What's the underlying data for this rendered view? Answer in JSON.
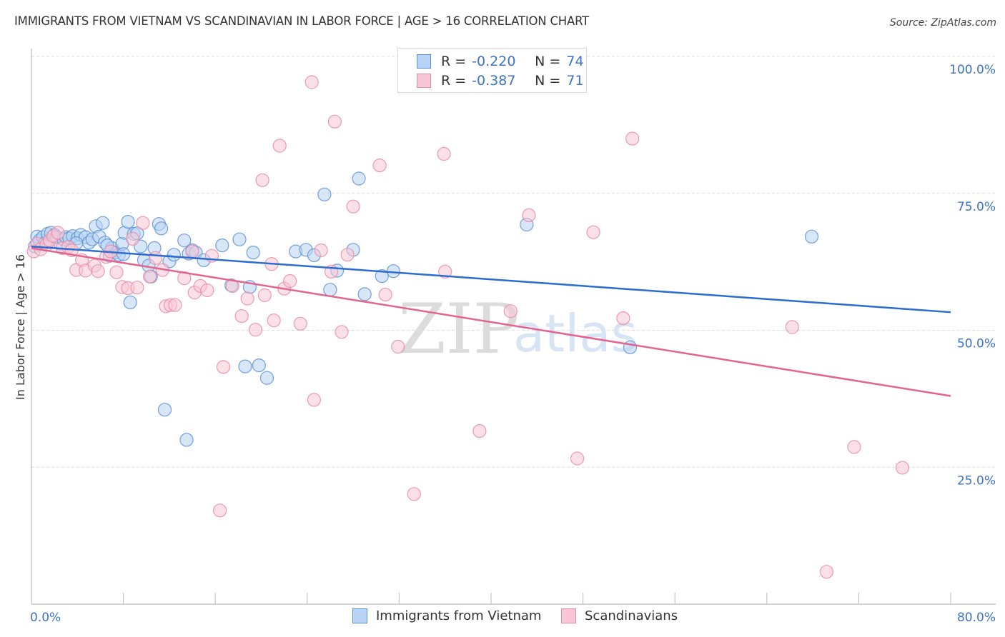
{
  "header": {
    "title": "IMMIGRANTS FROM VIETNAM VS SCANDINAVIAN IN LABOR FORCE | AGE > 16 CORRELATION CHART",
    "source": "Source: ZipAtlas.com"
  },
  "legend": {
    "rows": [
      {
        "r_label": "R =",
        "r_value": "-0.220",
        "n_label": "N =",
        "n_value": "74"
      },
      {
        "r_label": "R =",
        "r_value": "-0.387",
        "n_label": "N =",
        "n_value": "71"
      }
    ]
  },
  "bottom_legend": {
    "series_1": "Immigrants from Vietnam",
    "series_2": "Scandinavians"
  },
  "watermark": {
    "zip": "ZIP",
    "atlas": "atlas"
  },
  "colors": {
    "blue_fill": "#b8d3f3",
    "blue_stroke": "#5a8fd8",
    "blue_line": "#2a6ccf",
    "pink_fill": "#f9c6d5",
    "pink_stroke": "#e88aa6",
    "pink_line": "#e2648f",
    "tick_text": "#3b73c8",
    "grid": "#dddddd"
  },
  "chart_data": {
    "type": "scatter",
    "title": "IMMIGRANTS FROM VIETNAM VS SCANDINAVIAN IN LABOR FORCE | AGE > 16 CORRELATION CHART",
    "xlabel": "",
    "ylabel": "In Labor Force | Age > 16",
    "xlim": [
      0,
      80
    ],
    "ylim": [
      0,
      100
    ],
    "x_tick_labels": [
      "0.0%",
      "80.0%"
    ],
    "x_ticks": [
      0,
      8,
      16,
      24,
      32,
      40,
      48,
      56,
      64,
      72,
      80
    ],
    "y_ticks": [
      25,
      50,
      75,
      100
    ],
    "y_tick_labels": [
      "25.0%",
      "50.0%",
      "75.0%",
      "100.0%"
    ],
    "grid": "horizontal-dashed",
    "legend_position": "top-center",
    "series": [
      {
        "name": "Immigrants from Vietnam",
        "R": -0.22,
        "N": 74,
        "trend": {
          "x": [
            0,
            80
          ],
          "y": [
            65.3,
            53.3
          ]
        },
        "points": [
          [
            0.3,
            65.3
          ],
          [
            0.5,
            67.1
          ],
          [
            0.7,
            66.4
          ],
          [
            1.0,
            67.0
          ],
          [
            1.2,
            66.0
          ],
          [
            1.4,
            67.6
          ],
          [
            1.7,
            67.8
          ],
          [
            2.0,
            67.4
          ],
          [
            2.2,
            67.0
          ],
          [
            2.5,
            65.8
          ],
          [
            2.8,
            66.6
          ],
          [
            3.0,
            67.0
          ],
          [
            3.3,
            66.8
          ],
          [
            3.6,
            67.2
          ],
          [
            4.0,
            66.8
          ],
          [
            4.3,
            67.4
          ],
          [
            4.7,
            67.0
          ],
          [
            5.0,
            66.0
          ],
          [
            5.3,
            66.6
          ],
          [
            5.6,
            69.0
          ],
          [
            5.9,
            67.1
          ],
          [
            6.2,
            69.6
          ],
          [
            6.4,
            66.0
          ],
          [
            6.8,
            63.6
          ],
          [
            7.0,
            65.0
          ],
          [
            7.3,
            64.2
          ],
          [
            7.6,
            63.8
          ],
          [
            7.9,
            65.8
          ],
          [
            8.1,
            67.8
          ],
          [
            8.4,
            69.8
          ],
          [
            8.6,
            55.1
          ],
          [
            8.9,
            67.6
          ],
          [
            9.2,
            67.7
          ],
          [
            9.5,
            65.3
          ],
          [
            9.8,
            62.8
          ],
          [
            10.2,
            61.8
          ],
          [
            10.4,
            59.8
          ],
          [
            10.7,
            65.0
          ],
          [
            11.1,
            69.4
          ],
          [
            11.3,
            68.6
          ],
          [
            11.6,
            35.5
          ],
          [
            12.0,
            62.6
          ],
          [
            12.4,
            63.8
          ],
          [
            13.3,
            66.4
          ],
          [
            13.5,
            30.0
          ],
          [
            13.7,
            64.0
          ],
          [
            14.0,
            64.6
          ],
          [
            14.3,
            64.2
          ],
          [
            15.0,
            62.8
          ],
          [
            16.6,
            65.5
          ],
          [
            17.4,
            58.2
          ],
          [
            18.1,
            66.6
          ],
          [
            18.6,
            43.4
          ],
          [
            19.0,
            57.9
          ],
          [
            19.3,
            64.2
          ],
          [
            19.8,
            43.6
          ],
          [
            20.5,
            41.3
          ],
          [
            23.0,
            64.4
          ],
          [
            23.9,
            64.7
          ],
          [
            24.6,
            63.7
          ],
          [
            25.5,
            74.8
          ],
          [
            26.0,
            57.4
          ],
          [
            26.6,
            60.9
          ],
          [
            28.0,
            64.7
          ],
          [
            28.5,
            77.7
          ],
          [
            29.0,
            56.6
          ],
          [
            30.5,
            59.9
          ],
          [
            31.5,
            60.8
          ],
          [
            43.1,
            69.3
          ],
          [
            52.1,
            46.9
          ],
          [
            67.9,
            67.1
          ],
          [
            8.0,
            63.9
          ],
          [
            6.6,
            65.5
          ],
          [
            3.9,
            65.9
          ]
        ]
      },
      {
        "name": "Scandinavians",
        "R": -0.387,
        "N": 71,
        "trend": {
          "x": [
            0,
            80
          ],
          "y": [
            65.0,
            38.0
          ]
        },
        "points": [
          [
            0.2,
            64.4
          ],
          [
            0.5,
            65.8
          ],
          [
            0.8,
            64.8
          ],
          [
            1.3,
            65.6
          ],
          [
            1.6,
            66.4
          ],
          [
            1.9,
            67.2
          ],
          [
            2.3,
            67.8
          ],
          [
            2.7,
            65.0
          ],
          [
            3.2,
            65.2
          ],
          [
            3.5,
            64.6
          ],
          [
            3.9,
            61.0
          ],
          [
            4.4,
            62.8
          ],
          [
            4.7,
            60.9
          ],
          [
            5.5,
            61.8
          ],
          [
            5.8,
            60.8
          ],
          [
            6.5,
            63.4
          ],
          [
            6.9,
            64.4
          ],
          [
            7.4,
            60.6
          ],
          [
            7.9,
            57.9
          ],
          [
            8.4,
            57.7
          ],
          [
            8.8,
            66.7
          ],
          [
            9.2,
            57.8
          ],
          [
            9.7,
            69.6
          ],
          [
            10.3,
            59.8
          ],
          [
            10.8,
            63.2
          ],
          [
            11.4,
            61.0
          ],
          [
            11.7,
            54.4
          ],
          [
            12.1,
            54.6
          ],
          [
            12.5,
            54.6
          ],
          [
            13.3,
            59.5
          ],
          [
            14.0,
            64.4
          ],
          [
            14.2,
            56.9
          ],
          [
            14.7,
            58.1
          ],
          [
            15.3,
            57.3
          ],
          [
            15.7,
            63.6
          ],
          [
            16.4,
            17.1
          ],
          [
            16.7,
            43.3
          ],
          [
            17.5,
            58.1
          ],
          [
            18.3,
            52.6
          ],
          [
            18.8,
            55.8
          ],
          [
            19.5,
            50.1
          ],
          [
            20.1,
            77.4
          ],
          [
            20.3,
            56.4
          ],
          [
            20.9,
            62.1
          ],
          [
            21.1,
            51.8
          ],
          [
            21.6,
            83.7
          ],
          [
            22.0,
            57.6
          ],
          [
            22.5,
            59.0
          ],
          [
            23.4,
            51.2
          ],
          [
            24.4,
            95.3
          ],
          [
            24.6,
            37.3
          ],
          [
            25.2,
            64.6
          ],
          [
            26.1,
            60.7
          ],
          [
            26.4,
            88.1
          ],
          [
            27.0,
            49.7
          ],
          [
            27.5,
            63.8
          ],
          [
            28.0,
            72.6
          ],
          [
            30.3,
            80.1
          ],
          [
            30.8,
            56.5
          ],
          [
            31.9,
            47.0
          ],
          [
            33.3,
            20.1
          ],
          [
            35.9,
            82.2
          ],
          [
            36.0,
            60.7
          ],
          [
            39.0,
            31.6
          ],
          [
            41.7,
            53.5
          ],
          [
            43.3,
            71.0
          ],
          [
            47.5,
            26.6
          ],
          [
            48.9,
            67.9
          ],
          [
            51.5,
            52.2
          ],
          [
            52.3,
            85.0
          ],
          [
            66.2,
            50.6
          ],
          [
            69.2,
            5.9
          ],
          [
            71.6,
            28.7
          ],
          [
            75.8,
            24.9
          ]
        ]
      }
    ]
  }
}
